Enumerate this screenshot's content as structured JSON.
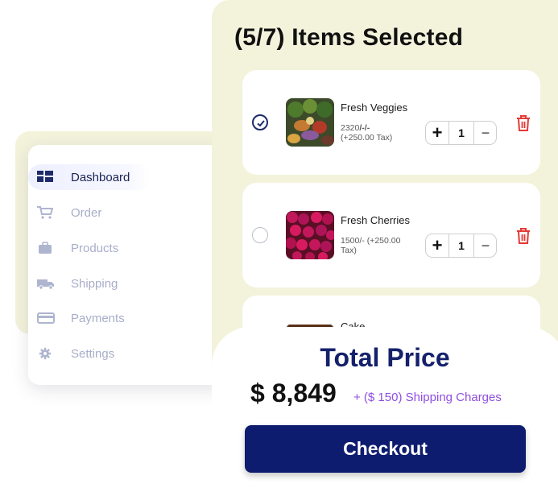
{
  "sidebar": {
    "items": [
      {
        "label": "Dashboard",
        "icon": "dashboard-icon",
        "active": true
      },
      {
        "label": "Order",
        "icon": "cart-icon",
        "active": false
      },
      {
        "label": "Products",
        "icon": "briefcase-icon",
        "active": false
      },
      {
        "label": "Shipping",
        "icon": "truck-icon",
        "active": false
      },
      {
        "label": "Payments",
        "icon": "credit-card-icon",
        "active": false
      },
      {
        "label": "Settings",
        "icon": "gear-icon",
        "active": false
      }
    ]
  },
  "cart": {
    "title": "(5/7) Items Selected",
    "items": [
      {
        "name": "Fresh Veggies",
        "price_main": "2320",
        "price_sep": "/-/-",
        "price_tax": "(+250.00 Tax)",
        "quantity": "1",
        "selected": true,
        "thumb_icon": "veggies-image"
      },
      {
        "name": "Fresh Cherries",
        "price": "1500/- (+250.00 Tax)",
        "quantity": "1",
        "selected": false,
        "thumb_icon": "cherries-image"
      },
      {
        "name": "Cake",
        "selected": false,
        "thumb_icon": "cake-image"
      }
    ],
    "stepper": {
      "plus": "+",
      "minus": "−"
    }
  },
  "summary": {
    "title": "Total Price",
    "amount": "$ 8,849",
    "shipping": "+ ($ 150) Shipping Charges",
    "checkout_label": "Checkout"
  },
  "colors": {
    "panel_bg": "#f3f3dc",
    "primary": "#0d1c6e",
    "accent_purple": "#8e4ee0",
    "delete_red": "#e53935",
    "muted_nav": "#a7aec9"
  }
}
